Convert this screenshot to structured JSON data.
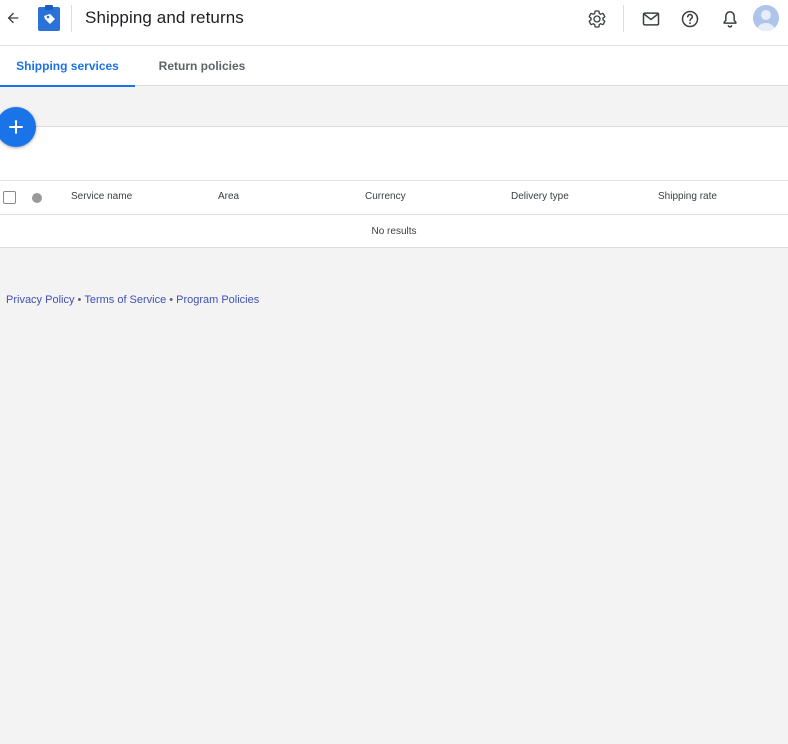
{
  "header": {
    "title": "Shipping and returns",
    "icons": [
      "arrow-back-icon",
      "merchant-tag-logo",
      "settings-gear-icon",
      "mail-icon",
      "help-icon",
      "notifications-bell-icon",
      "account-avatar"
    ],
    "accent_color": "#1a73e8"
  },
  "tabs": [
    {
      "label": "Shipping services",
      "selected": true
    },
    {
      "label": "Return policies",
      "selected": false
    }
  ],
  "table": {
    "columns": [
      "Service name",
      "Area",
      "Currency",
      "Delivery type",
      "Shipping rate"
    ],
    "empty_text": "No results"
  },
  "footer": {
    "links": [
      "Privacy Policy",
      "Terms of Service",
      "Program Policies"
    ],
    "separator": "•"
  }
}
